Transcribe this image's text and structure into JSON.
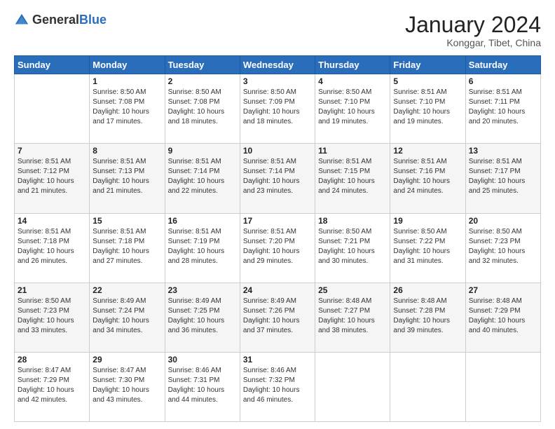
{
  "header": {
    "logo_general": "General",
    "logo_blue": "Blue",
    "month_year": "January 2024",
    "location": "Konggar, Tibet, China"
  },
  "weekdays": [
    "Sunday",
    "Monday",
    "Tuesday",
    "Wednesday",
    "Thursday",
    "Friday",
    "Saturday"
  ],
  "weeks": [
    [
      {
        "day": "",
        "sunrise": "",
        "sunset": "",
        "daylight": ""
      },
      {
        "day": "1",
        "sunrise": "Sunrise: 8:50 AM",
        "sunset": "Sunset: 7:08 PM",
        "daylight": "Daylight: 10 hours and 17 minutes."
      },
      {
        "day": "2",
        "sunrise": "Sunrise: 8:50 AM",
        "sunset": "Sunset: 7:08 PM",
        "daylight": "Daylight: 10 hours and 18 minutes."
      },
      {
        "day": "3",
        "sunrise": "Sunrise: 8:50 AM",
        "sunset": "Sunset: 7:09 PM",
        "daylight": "Daylight: 10 hours and 18 minutes."
      },
      {
        "day": "4",
        "sunrise": "Sunrise: 8:50 AM",
        "sunset": "Sunset: 7:10 PM",
        "daylight": "Daylight: 10 hours and 19 minutes."
      },
      {
        "day": "5",
        "sunrise": "Sunrise: 8:51 AM",
        "sunset": "Sunset: 7:10 PM",
        "daylight": "Daylight: 10 hours and 19 minutes."
      },
      {
        "day": "6",
        "sunrise": "Sunrise: 8:51 AM",
        "sunset": "Sunset: 7:11 PM",
        "daylight": "Daylight: 10 hours and 20 minutes."
      }
    ],
    [
      {
        "day": "7",
        "sunrise": "Sunrise: 8:51 AM",
        "sunset": "Sunset: 7:12 PM",
        "daylight": "Daylight: 10 hours and 21 minutes."
      },
      {
        "day": "8",
        "sunrise": "Sunrise: 8:51 AM",
        "sunset": "Sunset: 7:13 PM",
        "daylight": "Daylight: 10 hours and 21 minutes."
      },
      {
        "day": "9",
        "sunrise": "Sunrise: 8:51 AM",
        "sunset": "Sunset: 7:14 PM",
        "daylight": "Daylight: 10 hours and 22 minutes."
      },
      {
        "day": "10",
        "sunrise": "Sunrise: 8:51 AM",
        "sunset": "Sunset: 7:14 PM",
        "daylight": "Daylight: 10 hours and 23 minutes."
      },
      {
        "day": "11",
        "sunrise": "Sunrise: 8:51 AM",
        "sunset": "Sunset: 7:15 PM",
        "daylight": "Daylight: 10 hours and 24 minutes."
      },
      {
        "day": "12",
        "sunrise": "Sunrise: 8:51 AM",
        "sunset": "Sunset: 7:16 PM",
        "daylight": "Daylight: 10 hours and 24 minutes."
      },
      {
        "day": "13",
        "sunrise": "Sunrise: 8:51 AM",
        "sunset": "Sunset: 7:17 PM",
        "daylight": "Daylight: 10 hours and 25 minutes."
      }
    ],
    [
      {
        "day": "14",
        "sunrise": "Sunrise: 8:51 AM",
        "sunset": "Sunset: 7:18 PM",
        "daylight": "Daylight: 10 hours and 26 minutes."
      },
      {
        "day": "15",
        "sunrise": "Sunrise: 8:51 AM",
        "sunset": "Sunset: 7:18 PM",
        "daylight": "Daylight: 10 hours and 27 minutes."
      },
      {
        "day": "16",
        "sunrise": "Sunrise: 8:51 AM",
        "sunset": "Sunset: 7:19 PM",
        "daylight": "Daylight: 10 hours and 28 minutes."
      },
      {
        "day": "17",
        "sunrise": "Sunrise: 8:51 AM",
        "sunset": "Sunset: 7:20 PM",
        "daylight": "Daylight: 10 hours and 29 minutes."
      },
      {
        "day": "18",
        "sunrise": "Sunrise: 8:50 AM",
        "sunset": "Sunset: 7:21 PM",
        "daylight": "Daylight: 10 hours and 30 minutes."
      },
      {
        "day": "19",
        "sunrise": "Sunrise: 8:50 AM",
        "sunset": "Sunset: 7:22 PM",
        "daylight": "Daylight: 10 hours and 31 minutes."
      },
      {
        "day": "20",
        "sunrise": "Sunrise: 8:50 AM",
        "sunset": "Sunset: 7:23 PM",
        "daylight": "Daylight: 10 hours and 32 minutes."
      }
    ],
    [
      {
        "day": "21",
        "sunrise": "Sunrise: 8:50 AM",
        "sunset": "Sunset: 7:23 PM",
        "daylight": "Daylight: 10 hours and 33 minutes."
      },
      {
        "day": "22",
        "sunrise": "Sunrise: 8:49 AM",
        "sunset": "Sunset: 7:24 PM",
        "daylight": "Daylight: 10 hours and 34 minutes."
      },
      {
        "day": "23",
        "sunrise": "Sunrise: 8:49 AM",
        "sunset": "Sunset: 7:25 PM",
        "daylight": "Daylight: 10 hours and 36 minutes."
      },
      {
        "day": "24",
        "sunrise": "Sunrise: 8:49 AM",
        "sunset": "Sunset: 7:26 PM",
        "daylight": "Daylight: 10 hours and 37 minutes."
      },
      {
        "day": "25",
        "sunrise": "Sunrise: 8:48 AM",
        "sunset": "Sunset: 7:27 PM",
        "daylight": "Daylight: 10 hours and 38 minutes."
      },
      {
        "day": "26",
        "sunrise": "Sunrise: 8:48 AM",
        "sunset": "Sunset: 7:28 PM",
        "daylight": "Daylight: 10 hours and 39 minutes."
      },
      {
        "day": "27",
        "sunrise": "Sunrise: 8:48 AM",
        "sunset": "Sunset: 7:29 PM",
        "daylight": "Daylight: 10 hours and 40 minutes."
      }
    ],
    [
      {
        "day": "28",
        "sunrise": "Sunrise: 8:47 AM",
        "sunset": "Sunset: 7:29 PM",
        "daylight": "Daylight: 10 hours and 42 minutes."
      },
      {
        "day": "29",
        "sunrise": "Sunrise: 8:47 AM",
        "sunset": "Sunset: 7:30 PM",
        "daylight": "Daylight: 10 hours and 43 minutes."
      },
      {
        "day": "30",
        "sunrise": "Sunrise: 8:46 AM",
        "sunset": "Sunset: 7:31 PM",
        "daylight": "Daylight: 10 hours and 44 minutes."
      },
      {
        "day": "31",
        "sunrise": "Sunrise: 8:46 AM",
        "sunset": "Sunset: 7:32 PM",
        "daylight": "Daylight: 10 hours and 46 minutes."
      },
      {
        "day": "",
        "sunrise": "",
        "sunset": "",
        "daylight": ""
      },
      {
        "day": "",
        "sunrise": "",
        "sunset": "",
        "daylight": ""
      },
      {
        "day": "",
        "sunrise": "",
        "sunset": "",
        "daylight": ""
      }
    ]
  ]
}
